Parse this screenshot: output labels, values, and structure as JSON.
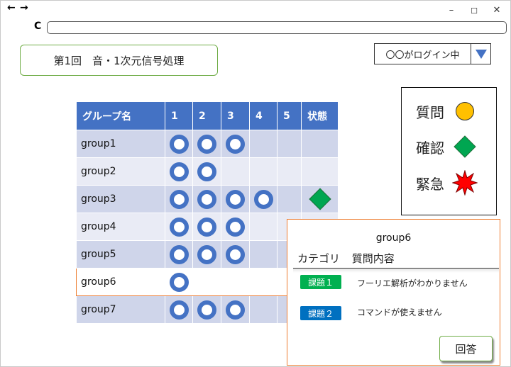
{
  "window": {
    "controls": {
      "minimize": "–",
      "maximize": "☐",
      "close": "✕"
    },
    "nav": {
      "back": "←",
      "forward": "→",
      "reload": "C"
    }
  },
  "title": "第1回　音・1次元信号処理",
  "login": {
    "text": "〇〇がログイン中"
  },
  "table": {
    "headers": [
      "グループ名",
      "1",
      "2",
      "3",
      "4",
      "5",
      "状態"
    ],
    "rows": [
      {
        "name": "group1",
        "rings": [
          true,
          true,
          true,
          false,
          false
        ],
        "status": ""
      },
      {
        "name": "group2",
        "rings": [
          true,
          true,
          false,
          false,
          false
        ],
        "status": ""
      },
      {
        "name": "group3",
        "rings": [
          true,
          true,
          true,
          true,
          false
        ],
        "status": "確認"
      },
      {
        "name": "group4",
        "rings": [
          true,
          true,
          true,
          false,
          false
        ],
        "status": ""
      },
      {
        "name": "group5",
        "rings": [
          true,
          true,
          true,
          false,
          false
        ],
        "status": ""
      },
      {
        "name": "group6",
        "rings": [
          true,
          false,
          false,
          false,
          false
        ],
        "status": "",
        "selected": true
      },
      {
        "name": "group7",
        "rings": [
          true,
          true,
          true,
          false,
          false
        ],
        "status": ""
      }
    ]
  },
  "legend": [
    {
      "label": "質問",
      "icon": "yellow-circle",
      "color": "#ffc000"
    },
    {
      "label": "確認",
      "icon": "green-diamond",
      "color": "#00a651"
    },
    {
      "label": "緊急",
      "icon": "red-starburst",
      "color": "#ff0000"
    }
  ],
  "popup": {
    "group": "group6",
    "col_category": "カテゴリ",
    "col_content": "質問内容",
    "items": [
      {
        "tag": "課題１",
        "tag_color": "#00b050",
        "text": "フーリエ解析がわかりません"
      },
      {
        "tag": "課題２",
        "tag_color": "#0070c0",
        "text": "コマンドが使えません"
      }
    ],
    "answer_label": "回答"
  }
}
